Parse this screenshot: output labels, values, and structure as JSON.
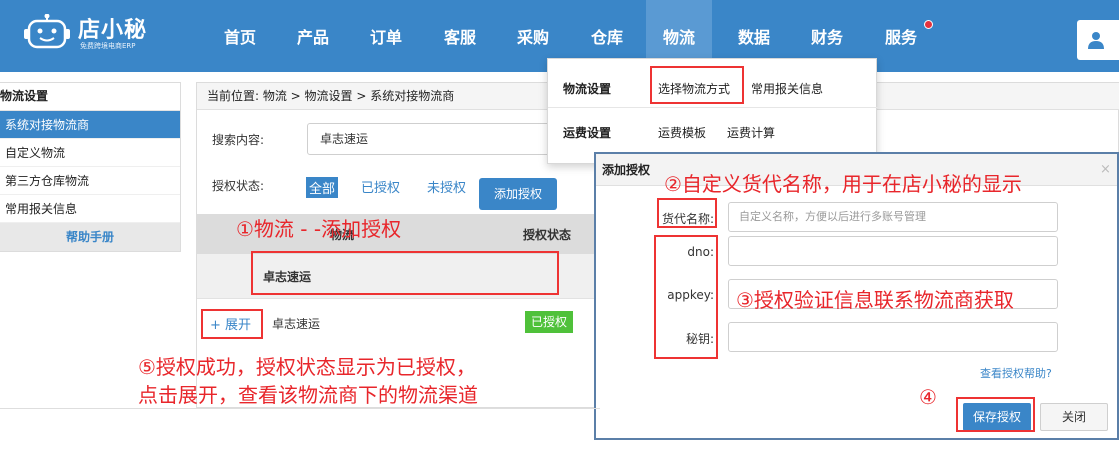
{
  "app": {
    "logo_text": "店小秘",
    "logo_sub": "免费跨境电商ERP"
  },
  "nav": {
    "items": [
      "首页",
      "产品",
      "订单",
      "客服",
      "采购",
      "仓库",
      "物流",
      "数据",
      "财务",
      "服务"
    ],
    "active_index": 6,
    "active_color": "#5a9ad3",
    "bar_color": "#3a86c8"
  },
  "sidebar": {
    "title": "物流设置",
    "items": [
      "系统对接物流商",
      "自定义物流",
      "第三方仓库物流",
      "常用报关信息"
    ],
    "active_index": 0,
    "help": "帮助手册"
  },
  "breadcrumb": "当前位置: 物流 > 物流设置 > 系统对接物流商",
  "search": {
    "label": "搜索内容:",
    "value": "卓志速运"
  },
  "filter": {
    "label": "授权状态:",
    "options": [
      "全部",
      "已授权",
      "未授权"
    ],
    "selected_index": 0
  },
  "table": {
    "headers": [
      "物流",
      "授权状态"
    ],
    "group_name": "卓志速运",
    "add_button": "添加授权",
    "row": {
      "expand": "+ 展开",
      "name": "卓志速运",
      "status": "已授权",
      "status_color": "#4fc13a"
    }
  },
  "dropdown": {
    "row1": {
      "head": "物流设置",
      "items": [
        "选择物流方式",
        "常用报关信息"
      ]
    },
    "row2": {
      "head": "运费设置",
      "items": [
        "运费模板",
        "运费计算"
      ]
    }
  },
  "modal": {
    "title": "添加授权",
    "close": "×",
    "fields": [
      {
        "label": "货代名称:",
        "placeholder": "自定义名称，方便以后进行多账号管理"
      },
      {
        "label": "dno:",
        "placeholder": ""
      },
      {
        "label": "appkey:",
        "placeholder": ""
      },
      {
        "label": "秘钥:",
        "placeholder": ""
      }
    ],
    "help_link": "查看授权帮助?",
    "save": "保存授权",
    "cancel": "关闭"
  },
  "annotations": {
    "a1": "①物流 - -添加授权",
    "a2": "②自定义货代名称，用于在店小秘的显示",
    "a3": "③授权验证信息联系物流商获取",
    "a4": "④",
    "a5_line1": "⑤授权成功，授权状态显示为已授权，",
    "a5_line2": "点击展开，查看该物流商下的物流渠道",
    "color": "#e8262b"
  }
}
